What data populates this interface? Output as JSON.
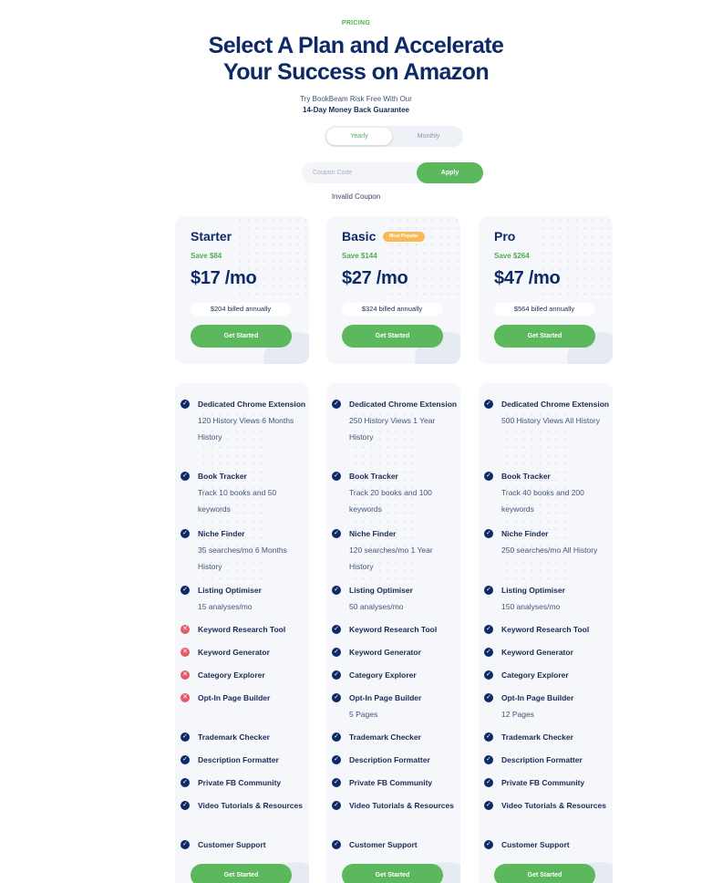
{
  "header": {
    "eyebrow": "PRICING",
    "title_line1": "Select A Plan and Accelerate",
    "title_line2": "Your Success on Amazon",
    "sub1": "Try BookBeam Risk Free With Our",
    "sub2": "14-Day Money Back Guarantee"
  },
  "toggle": {
    "yearly": "Yearly",
    "monthly": "Monthly",
    "selected": "Yearly"
  },
  "coupon": {
    "placeholder": "Coupon Code",
    "value": "",
    "apply": "Apply",
    "message": "Invalid Coupon"
  },
  "colors": {
    "accent": "#5cb85c",
    "navy": "#0e2a66",
    "badge": "#f6bb54",
    "error": "#e35b66"
  },
  "plans": [
    {
      "name": "Starter",
      "badge": "",
      "save": "Save $84",
      "price": "$17 /mo",
      "billed": "$204 billed annually",
      "cta": "Get Started",
      "features": [
        {
          "name": "Dedicated Chrome Extension",
          "desc": "120 History Views 6 Months History",
          "included": true
        },
        {
          "name": "Book Tracker",
          "desc": "Track 10 books and 50 keywords",
          "included": true
        },
        {
          "name": "Niche Finder",
          "desc": "35 searches/mo 6 Months History",
          "included": true
        },
        {
          "name": "Listing Optimiser",
          "desc": "15 analyses/mo",
          "included": true
        },
        {
          "name": "Keyword Research Tool",
          "desc": "",
          "included": false
        },
        {
          "name": "Keyword Generator",
          "desc": "",
          "included": false
        },
        {
          "name": "Category Explorer",
          "desc": "",
          "included": false
        },
        {
          "name": "Opt-In Page Builder",
          "desc": "",
          "included": false
        },
        {
          "name": "Trademark Checker",
          "desc": "",
          "included": true
        },
        {
          "name": "Description Formatter",
          "desc": "",
          "included": true
        },
        {
          "name": "Private FB Community",
          "desc": "",
          "included": true
        },
        {
          "name": "Video Tutorials & Resources",
          "desc": "",
          "included": true
        },
        {
          "name": "Customer Support",
          "desc": "",
          "included": true
        }
      ]
    },
    {
      "name": "Basic",
      "badge": "Most Popular",
      "save": "Save $144",
      "price": "$27 /mo",
      "billed": "$324 billed annually",
      "cta": "Get Started",
      "features": [
        {
          "name": "Dedicated Chrome Extension",
          "desc": "250 History Views 1 Year History",
          "included": true
        },
        {
          "name": "Book Tracker",
          "desc": "Track 20 books and 100 keywords",
          "included": true
        },
        {
          "name": "Niche Finder",
          "desc": "120 searches/mo 1 Year History",
          "included": true
        },
        {
          "name": "Listing Optimiser",
          "desc": "50 analyses/mo",
          "included": true
        },
        {
          "name": "Keyword Research Tool",
          "desc": "",
          "included": true
        },
        {
          "name": "Keyword Generator",
          "desc": "",
          "included": true
        },
        {
          "name": "Category Explorer",
          "desc": "",
          "included": true
        },
        {
          "name": "Opt-In Page Builder",
          "desc": "5 Pages",
          "included": true
        },
        {
          "name": "Trademark Checker",
          "desc": "",
          "included": true
        },
        {
          "name": "Description Formatter",
          "desc": "",
          "included": true
        },
        {
          "name": "Private FB Community",
          "desc": "",
          "included": true
        },
        {
          "name": "Video Tutorials & Resources",
          "desc": "",
          "included": true
        },
        {
          "name": "Customer Support",
          "desc": "",
          "included": true
        }
      ]
    },
    {
      "name": "Pro",
      "badge": "",
      "save": "Save $264",
      "price": "$47 /mo",
      "billed": "$564 billed annually",
      "cta": "Get Started",
      "features": [
        {
          "name": "Dedicated Chrome Extension",
          "desc": "500 History Views All History",
          "included": true
        },
        {
          "name": "Book Tracker",
          "desc": "Track 40 books and 200 keywords",
          "included": true
        },
        {
          "name": "Niche Finder",
          "desc": "250 searches/mo All History",
          "included": true
        },
        {
          "name": "Listing Optimiser",
          "desc": "150 analyses/mo",
          "included": true
        },
        {
          "name": "Keyword Research Tool",
          "desc": "",
          "included": true
        },
        {
          "name": "Keyword Generator",
          "desc": "",
          "included": true
        },
        {
          "name": "Category Explorer",
          "desc": "",
          "included": true
        },
        {
          "name": "Opt-In Page Builder",
          "desc": "12 Pages",
          "included": true
        },
        {
          "name": "Trademark Checker",
          "desc": "",
          "included": true
        },
        {
          "name": "Description Formatter",
          "desc": "",
          "included": true
        },
        {
          "name": "Private FB Community",
          "desc": "",
          "included": true
        },
        {
          "name": "Video Tutorials & Resources",
          "desc": "",
          "included": true
        },
        {
          "name": "Customer Support",
          "desc": "",
          "included": true
        }
      ]
    }
  ]
}
